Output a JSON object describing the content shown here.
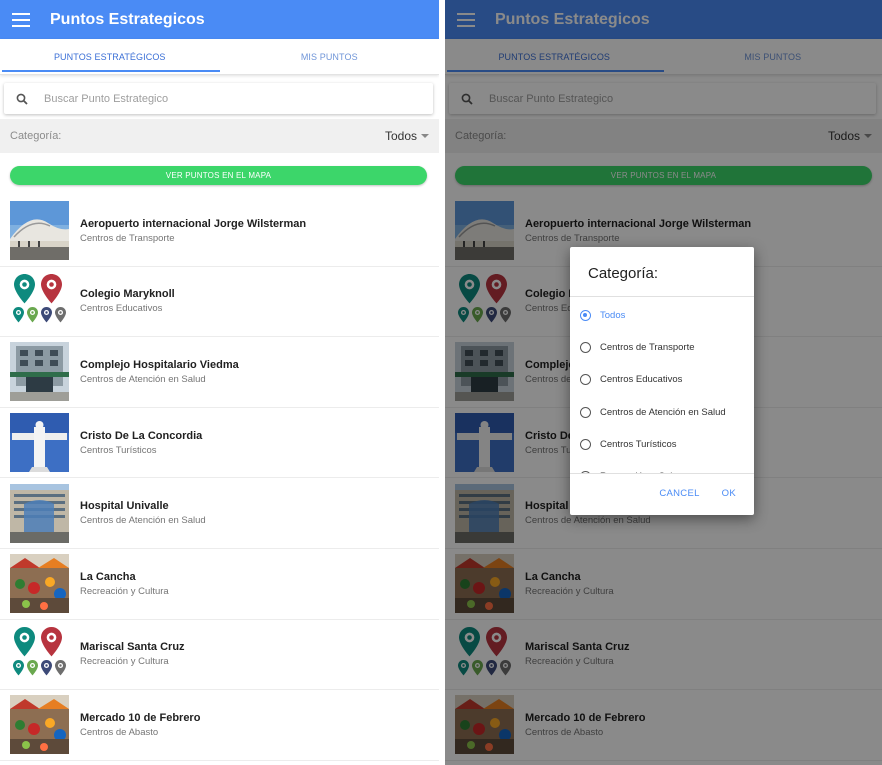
{
  "appbar": {
    "title": "Puntos Estrategicos"
  },
  "tabs": [
    {
      "label": "PUNTOS ESTRATÉGICOS",
      "active": true
    },
    {
      "label": "MIS PUNTOS",
      "active": false
    }
  ],
  "search": {
    "placeholder": "Buscar Punto Estrategico"
  },
  "category_bar": {
    "label": "Categoría:",
    "selected": "Todos"
  },
  "map_button": {
    "label": "VER PUNTOS EN EL MAPA"
  },
  "items": [
    {
      "title": "Aeropuerto internacional Jorge Wilsterman",
      "category": "Centros de Transporte",
      "thumb": "airport-photo"
    },
    {
      "title": "Colegio Maryknoll",
      "category": "Centros Educativos",
      "thumb": "map-pins-icon"
    },
    {
      "title": "Complejo Hospitalario Viedma",
      "category": "Centros de Atención en Salud",
      "thumb": "hospital-photo"
    },
    {
      "title": "Cristo De La Concordia",
      "category": "Centros Turísticos",
      "thumb": "statue-photo"
    },
    {
      "title": "Hospital Univalle",
      "category": "Centros de Atención en Salud",
      "thumb": "building-photo"
    },
    {
      "title": "La Cancha",
      "category": "Recreación y Cultura",
      "thumb": "market-photo"
    },
    {
      "title": "Mariscal Santa Cruz",
      "category": "Recreación y Cultura",
      "thumb": "map-pins-icon"
    },
    {
      "title": "Mercado 10 de Febrero",
      "category": "Centros de Abasto",
      "thumb": "market-photo"
    }
  ],
  "dialog": {
    "title": "Categoría:",
    "options": [
      {
        "label": "Todos",
        "checked": true
      },
      {
        "label": "Centros de Transporte",
        "checked": false
      },
      {
        "label": "Centros Educativos",
        "checked": false
      },
      {
        "label": "Centros de Atención en Salud",
        "checked": false
      },
      {
        "label": "Centros Turísticos",
        "checked": false
      },
      {
        "label": "Recreación y Cultura",
        "checked": false
      }
    ],
    "cancel_label": "CANCEL",
    "ok_label": "OK"
  },
  "colors": {
    "appbar": "#4a8bf5",
    "map_button": "#3cd66a",
    "accent": "#4a8bf5"
  }
}
